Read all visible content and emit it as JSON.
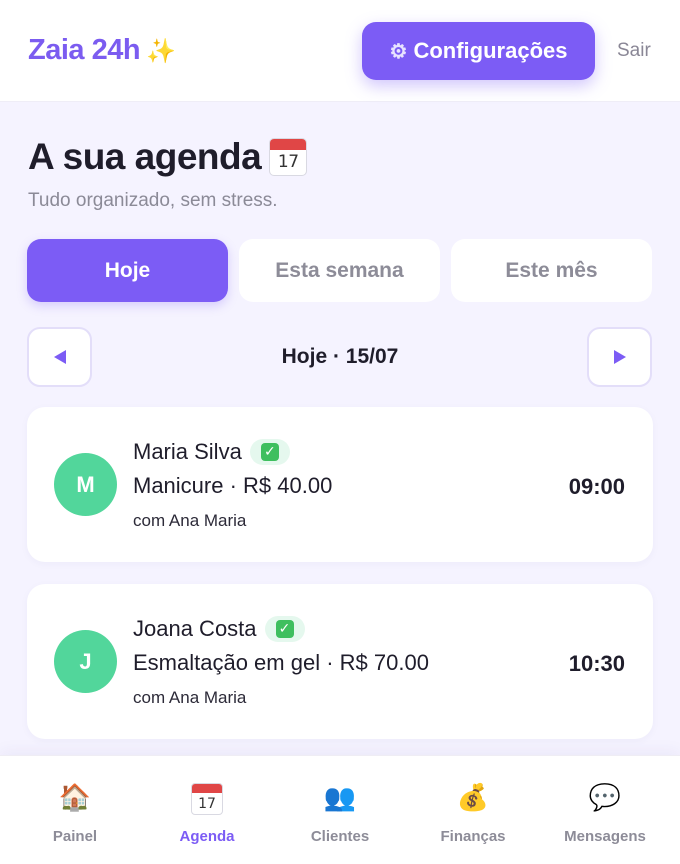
{
  "header": {
    "brand": "Zaia 24h",
    "brand_icon": "sparkles-icon",
    "config_label": "Configurações",
    "config_icon": "gear-icon",
    "logout_label": "Sair"
  },
  "page": {
    "title": "A sua agenda",
    "title_icon": "calendar-icon",
    "calendar_day": "17",
    "subtitle": "Tudo organizado, sem stress."
  },
  "tabs": [
    {
      "label": "Hoje",
      "active": true
    },
    {
      "label": "Esta semana",
      "active": false
    },
    {
      "label": "Este mês",
      "active": false
    }
  ],
  "date_nav": {
    "label": "Hoje · 15/07",
    "prev_icon": "triangle-left-icon",
    "next_icon": "triangle-right-icon"
  },
  "appointments": [
    {
      "initial": "M",
      "client": "Maria Silva",
      "service": "Manicure · R$ 40.00",
      "staff": "com Ana Maria",
      "time": "09:00",
      "confirmed_icon": "check-mark-icon",
      "check_glyph": "✓"
    },
    {
      "initial": "J",
      "client": "Joana Costa",
      "service": "Esmaltação em gel · R$ 70.00",
      "staff": "com Ana Maria",
      "time": "10:30",
      "confirmed_icon": "check-mark-icon",
      "check_glyph": "✓"
    }
  ],
  "bottom_nav": [
    {
      "label": "Painel",
      "icon": "house-icon",
      "glyph": "🏠",
      "active": false
    },
    {
      "label": "Agenda",
      "icon": "calendar-icon",
      "day": "17",
      "active": true
    },
    {
      "label": "Clientes",
      "icon": "users-icon",
      "glyph": "👥",
      "active": false
    },
    {
      "label": "Finanças",
      "icon": "money-bag-icon",
      "glyph": "💰",
      "active": false
    },
    {
      "label": "Mensagens",
      "icon": "speech-bubble-icon",
      "glyph": "💬",
      "active": false
    }
  ],
  "colors": {
    "accent": "#7c5cf5",
    "background": "#f5f3ff",
    "avatar": "#52d69b",
    "confirmed": "#3fbf5f"
  }
}
